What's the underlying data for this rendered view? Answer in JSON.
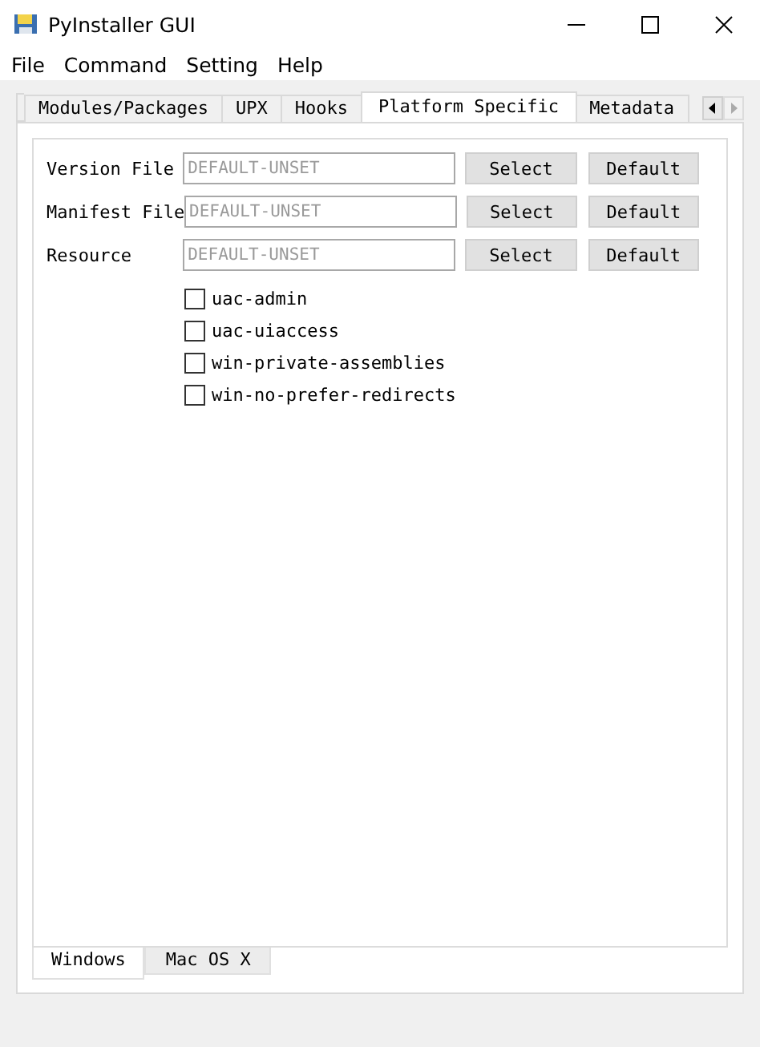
{
  "window": {
    "title": "PyInstaller GUI"
  },
  "menu": [
    "File",
    "Command",
    "Setting",
    "Help"
  ],
  "tabs": [
    {
      "label": "Modules/Packages",
      "selected": false
    },
    {
      "label": "UPX",
      "selected": false
    },
    {
      "label": "Hooks",
      "selected": false
    },
    {
      "label": "Platform Specific",
      "selected": true
    },
    {
      "label": "Metadata",
      "selected": false
    }
  ],
  "file_rows": [
    {
      "label": "Version File",
      "placeholder": "DEFAULT-UNSET",
      "buttons": [
        "Select",
        "Default"
      ]
    },
    {
      "label": "Manifest File",
      "placeholder": "DEFAULT-UNSET",
      "buttons": [
        "Select",
        "Default"
      ]
    },
    {
      "label": "Resource",
      "placeholder": "DEFAULT-UNSET",
      "buttons": [
        "Select",
        "Default"
      ]
    }
  ],
  "options": [
    {
      "label": "uac-admin",
      "checked": false
    },
    {
      "label": "uac-uiaccess",
      "checked": false
    },
    {
      "label": "win-private-assemblies",
      "checked": false
    },
    {
      "label": "win-no-prefer-redirects",
      "checked": false
    }
  ],
  "platform_tabs": [
    {
      "label": "Windows",
      "selected": true
    },
    {
      "label": "Mac OS X",
      "selected": false
    }
  ]
}
